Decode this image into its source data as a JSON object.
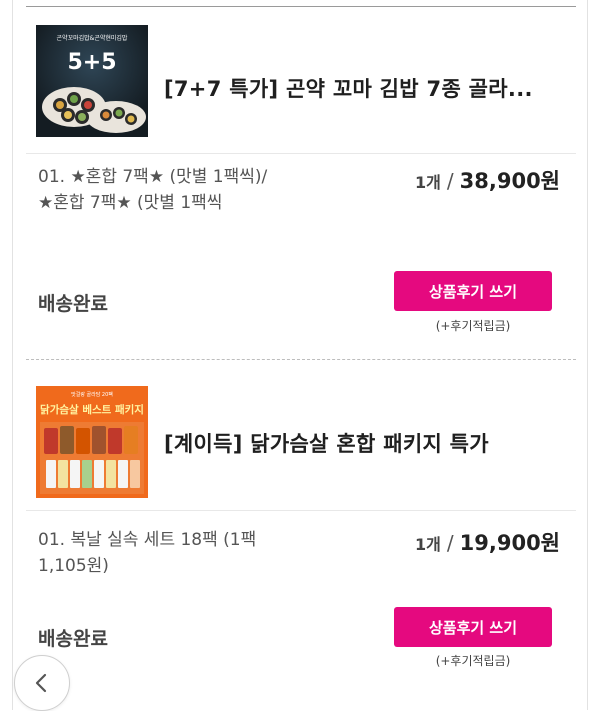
{
  "orders": [
    {
      "product_title": "[7+7 특가] 곤약 꼬마 김밥 7종 골라...",
      "thumbnail": {
        "icon": "gimbap-product-image",
        "banner_text": "곤약꼬마김밥&곤약현미김밥",
        "promo_text": "5+5",
        "bg_color": "#1e2a33"
      },
      "option": "01. ★혼합 7팩★ (맛별 1팩씩)/★혼합 7팩★ (맛별 1팩씩",
      "quantity": "1개",
      "separator": "/",
      "price": "38,900원",
      "status": "배송완료",
      "review_button_label": "상품후기 쓰기",
      "review_note": "(+후기적립금)"
    },
    {
      "product_title": "[계이득] 닭가슴살 혼합 패키지 특가",
      "thumbnail": {
        "icon": "chicken-breast-product-image",
        "banner_text": "맛걸랑 골라담 20팩",
        "promo_text": "닭가슴살 베스트 패키지",
        "bg_color": "#f06a1c"
      },
      "option": "01. 복날 실속 세트 18팩 (1팩 1,105원)",
      "quantity": "1개",
      "separator": "/",
      "price": "19,900원",
      "status": "배송완료",
      "review_button_label": "상품후기 쓰기",
      "review_note": "(+후기적립금)"
    }
  ],
  "accent_color": "#e5097f",
  "back_button": {
    "icon": "chevron-left-icon"
  }
}
